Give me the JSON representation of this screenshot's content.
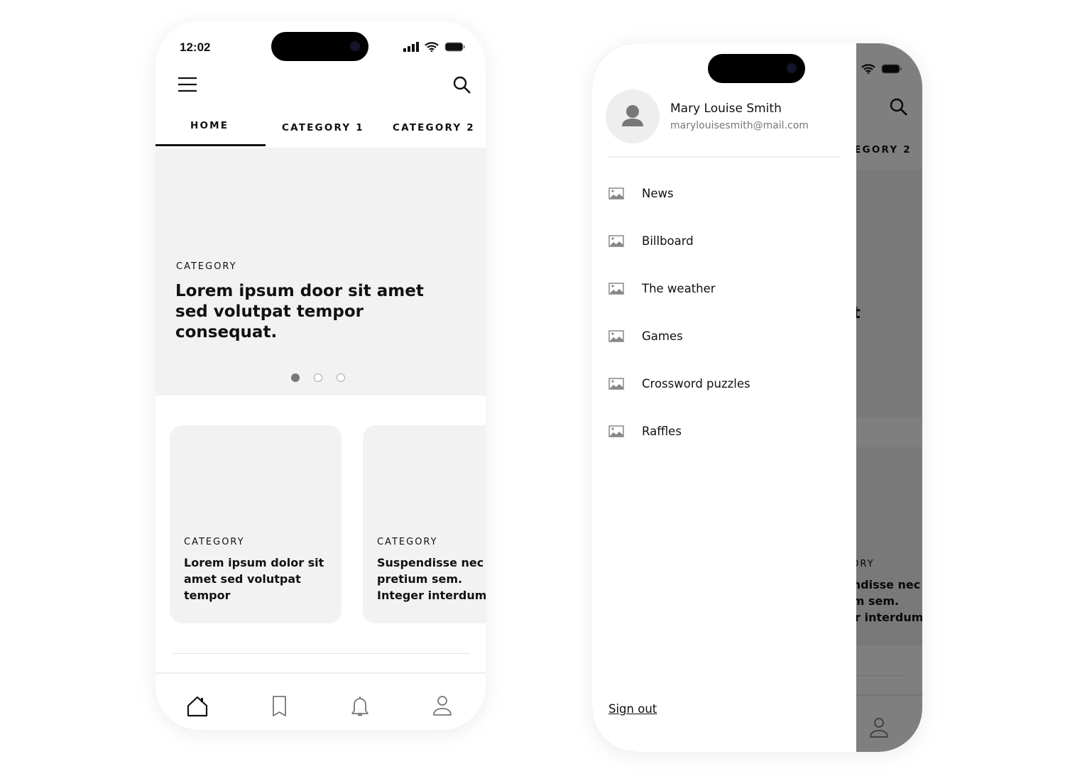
{
  "status_bar": {
    "time": "12:02"
  },
  "tabs": [
    {
      "label": "HOME",
      "active": true
    },
    {
      "label": "CATEGORY 1"
    },
    {
      "label": "CATEGORY 2"
    }
  ],
  "hero": {
    "category": "CATEGORY",
    "title": "Lorem ipsum door sit amet sed volutpat tempor consequat.",
    "slides": 3,
    "active_slide": 1
  },
  "cards": [
    {
      "category": "CATEGORY",
      "title": "Lorem ipsum dolor sit amet sed volutpat tempor"
    },
    {
      "category": "CATEGORY",
      "title": "Suspendisse nec pretium sem. Integer interdum"
    }
  ],
  "bottom_nav": [
    {
      "icon": "home-icon",
      "active": true
    },
    {
      "icon": "bookmark-icon"
    },
    {
      "icon": "bell-icon"
    },
    {
      "icon": "user-icon"
    }
  ],
  "drawer": {
    "user": {
      "name": "Mary Louise Smith",
      "email": "marylouisesmith@mail.com"
    },
    "items": [
      {
        "label": "News",
        "icon": "image-icon"
      },
      {
        "label": "Billboard",
        "icon": "image-icon"
      },
      {
        "label": "The weather",
        "icon": "image-icon"
      },
      {
        "label": "Games",
        "icon": "image-icon"
      },
      {
        "label": "Crossword puzzles",
        "icon": "image-icon"
      },
      {
        "label": "Raffles",
        "icon": "image-icon"
      }
    ],
    "sign_out": "Sign out"
  },
  "colors": {
    "placeholder": "#f2f2f2",
    "text": "#111111",
    "overlay": "rgba(0,0,0,0.5)"
  }
}
